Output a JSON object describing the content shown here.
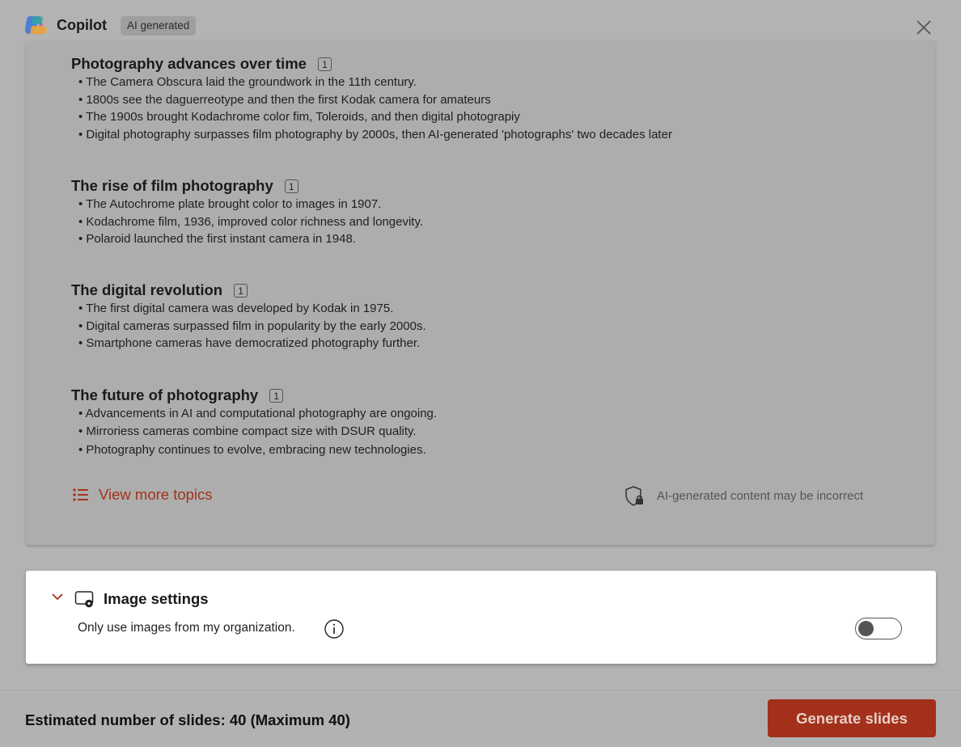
{
  "header": {
    "app_title": "Copilot",
    "badge": "AI generated",
    "icons": {
      "logo": "copilot-logo",
      "close": "close-icon"
    }
  },
  "topics": [
    {
      "title": "Photography advances over time",
      "citation": "1",
      "bullets": [
        "The Camera Obscura laid the groundwork in the 11th century.",
        "1800s see the daguerreotype and then the first Kodak camera for amateurs",
        "The 1900s brought Kodachrome color fim, Toleroids, and then digital photograpiy",
        "Digital photography surpasses film photography by 2000s, then AI-generated 'photographs' two decades later"
      ]
    },
    {
      "title": "The rise of film photography",
      "citation": "1",
      "bullets": [
        "The Autochrome plate brought color to images in 1907.",
        "Kodachrome film, 1936, improved color richness and longevity.",
        "Polaroid launched the first instant camera in 1948."
      ]
    },
    {
      "title": "The digital revolution",
      "citation": "1",
      "bullets": [
        "The first digital camera was developed by Kodak in 1975.",
        "Digital cameras surpassed film in popularity by the early 2000s.",
        "Smartphone cameras have democratized photography further."
      ]
    },
    {
      "title": "The future of photography",
      "citation": "1",
      "bullets": [
        "Advancements in AI and computational photography are ongoing.",
        "Mirroriess cameras combine compact size with DSUR quality.",
        "Photography continues to evolve, embracing new technologies."
      ]
    }
  ],
  "actions": {
    "view_more": "View more topics",
    "disclaimer": "AI-generated content may be incorrect"
  },
  "image_settings": {
    "title": "Image settings",
    "option_label": "Only use images from my organization.",
    "toggle_on": false
  },
  "footer": {
    "estimate": "Estimated number of slides: 40 (Maximum 40)",
    "generate_label": "Generate slides"
  },
  "colors": {
    "accent": "#a3301a",
    "overlay": "#b3b3b3"
  }
}
